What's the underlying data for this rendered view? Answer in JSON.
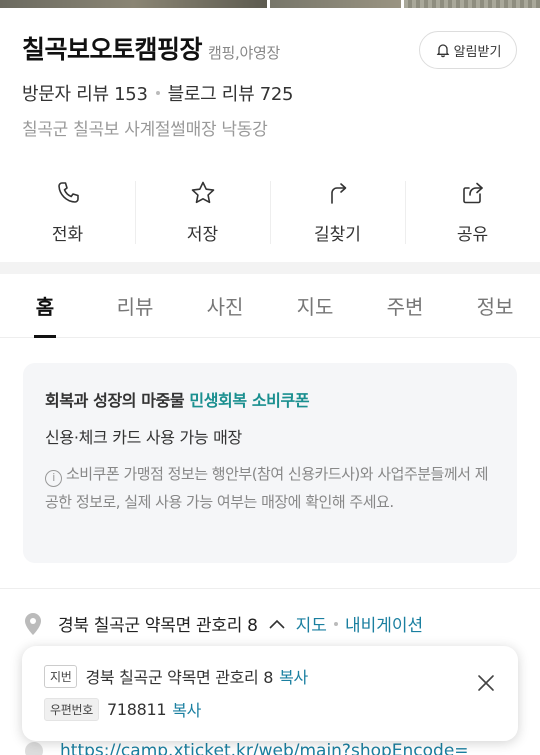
{
  "place": {
    "name": "칠곡보오토캠핑장",
    "category": "캠핑,야영장",
    "alarm_label": "알림받기",
    "visitor_review": "방문자 리뷰 153",
    "blog_review": "블로그 리뷰 725",
    "address_summary": "칠곡군 칠곡보 사계절썰매장 낙동강"
  },
  "actions": [
    {
      "label": "전화",
      "icon": "phone-icon"
    },
    {
      "label": "저장",
      "icon": "star-icon"
    },
    {
      "label": "길찾기",
      "icon": "directions-icon"
    },
    {
      "label": "공유",
      "icon": "share-icon"
    }
  ],
  "tabs": [
    "홈",
    "리뷰",
    "사진",
    "지도",
    "주변",
    "정보"
  ],
  "active_tab": "홈",
  "coupon": {
    "head_prefix": "회복과 성장의 마중물",
    "head_highlight": "민생회복 소비쿠폰",
    "sub": "신용·체크 카드 사용 가능 매장",
    "note": "소비쿠폰 가맹점 정보는 행안부(참여 신용카드사)와 사업주분들께서 제공한 정보로, 실제 사용 가능 여부는 매장에 확인해 주세요."
  },
  "address": {
    "text": "경북 칠곡군 약목면 관호리 8",
    "map_link": "지도",
    "nav_link": "내비게이션"
  },
  "popup": {
    "lot_tag": "지번",
    "lot_address": "경북 칠곡군 약목면 관호리 8",
    "copy_label": "복사",
    "zip_tag": "우편번호",
    "zip": "718811",
    "copy_label2": "복사"
  },
  "url_peek": "https://camp.xticket.kr/web/main?shopEncode=",
  "colors": {
    "accent": "#1a8f8f",
    "link": "#1a7fa0"
  }
}
